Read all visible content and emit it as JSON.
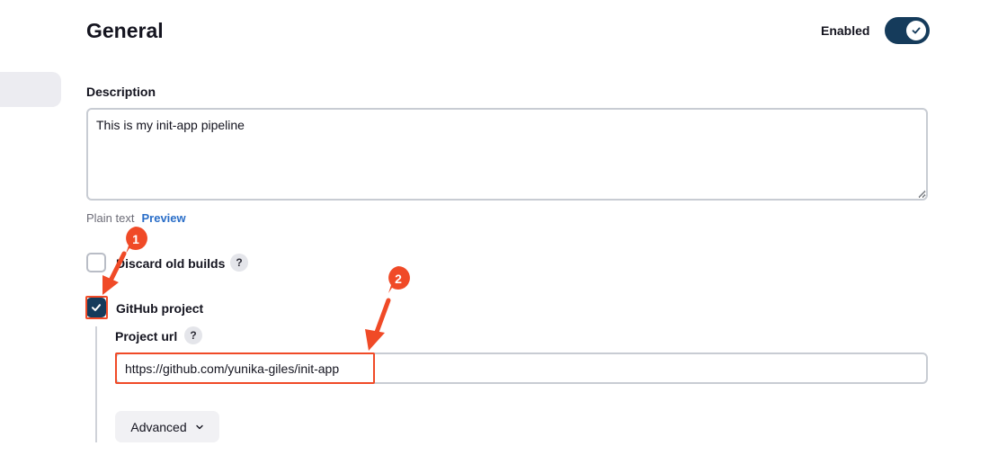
{
  "section": {
    "title": "General"
  },
  "enable_toggle": {
    "label": "Enabled",
    "on": true
  },
  "description": {
    "label": "Description",
    "value": "This is my init-app pipeline",
    "format_plain": "Plain text",
    "format_preview": "Preview"
  },
  "options": {
    "discard_old_builds": {
      "label": "Discard old builds",
      "checked": false,
      "help": "?"
    },
    "github_project": {
      "label": "GitHub project",
      "checked": true
    }
  },
  "project_url": {
    "label": "Project url",
    "help": "?",
    "value": "https://github.com/yunika-giles/init-app"
  },
  "advanced": {
    "label": "Advanced"
  },
  "annotations": {
    "step1": "1",
    "step2": "2",
    "color": "#f04a27"
  },
  "colors": {
    "accent": "#153b5b",
    "link": "#2a6ec8",
    "annotation": "#f04a27"
  }
}
